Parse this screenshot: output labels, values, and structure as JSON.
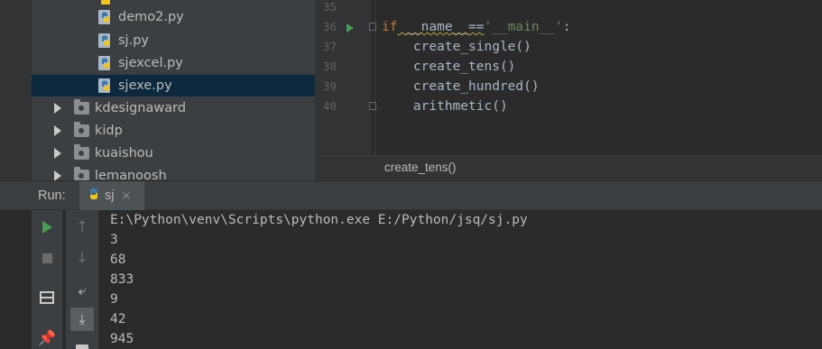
{
  "project_tree": {
    "files": [
      {
        "name": "demo2.py"
      },
      {
        "name": "sj.py"
      },
      {
        "name": "sjexcel.py"
      },
      {
        "name": "sjexe.py",
        "selected": true
      }
    ],
    "folders": [
      {
        "name": "kdesignaward"
      },
      {
        "name": "kidp"
      },
      {
        "name": "kuaishou"
      },
      {
        "name": "lemanoosh"
      }
    ]
  },
  "editor": {
    "lines": [
      {
        "number": "35"
      },
      {
        "number": "36",
        "if_kw": "if",
        "name_part": " __name__",
        "eq": "==",
        "str": "'__main__'",
        "colon": ":"
      },
      {
        "number": "37",
        "text": "    create_single()"
      },
      {
        "number": "38",
        "text": "    create_tens()"
      },
      {
        "number": "39",
        "text": "    create_hundred()"
      },
      {
        "number": "40",
        "text": "    arithmetic()"
      }
    ],
    "breadcrumb": "create_tens()"
  },
  "run_panel": {
    "label": "Run:",
    "tab_label": "sj",
    "tab_close": "×"
  },
  "console": {
    "lines": [
      "E:\\Python\\venv\\Scripts\\python.exe E:/Python/jsq/sj.py",
      "3",
      "68",
      "833",
      "9",
      "42",
      "945"
    ]
  },
  "icons": {
    "python": "python-file-icon",
    "folder": "folder-icon",
    "expand": "chevron-right-icon",
    "run": "run-icon",
    "stop": "stop-icon",
    "up": "arrow-up-icon",
    "down": "arrow-down-icon",
    "soft_wrap": "soft-wrap-icon",
    "scroll_end": "scroll-to-end-icon",
    "layout": "layout-icon",
    "pin": "pin-icon",
    "print": "print-icon"
  },
  "colors": {
    "selection": "#0d293e",
    "keyword": "#cc7832",
    "string": "#6a8759",
    "run_green": "#499c54"
  }
}
